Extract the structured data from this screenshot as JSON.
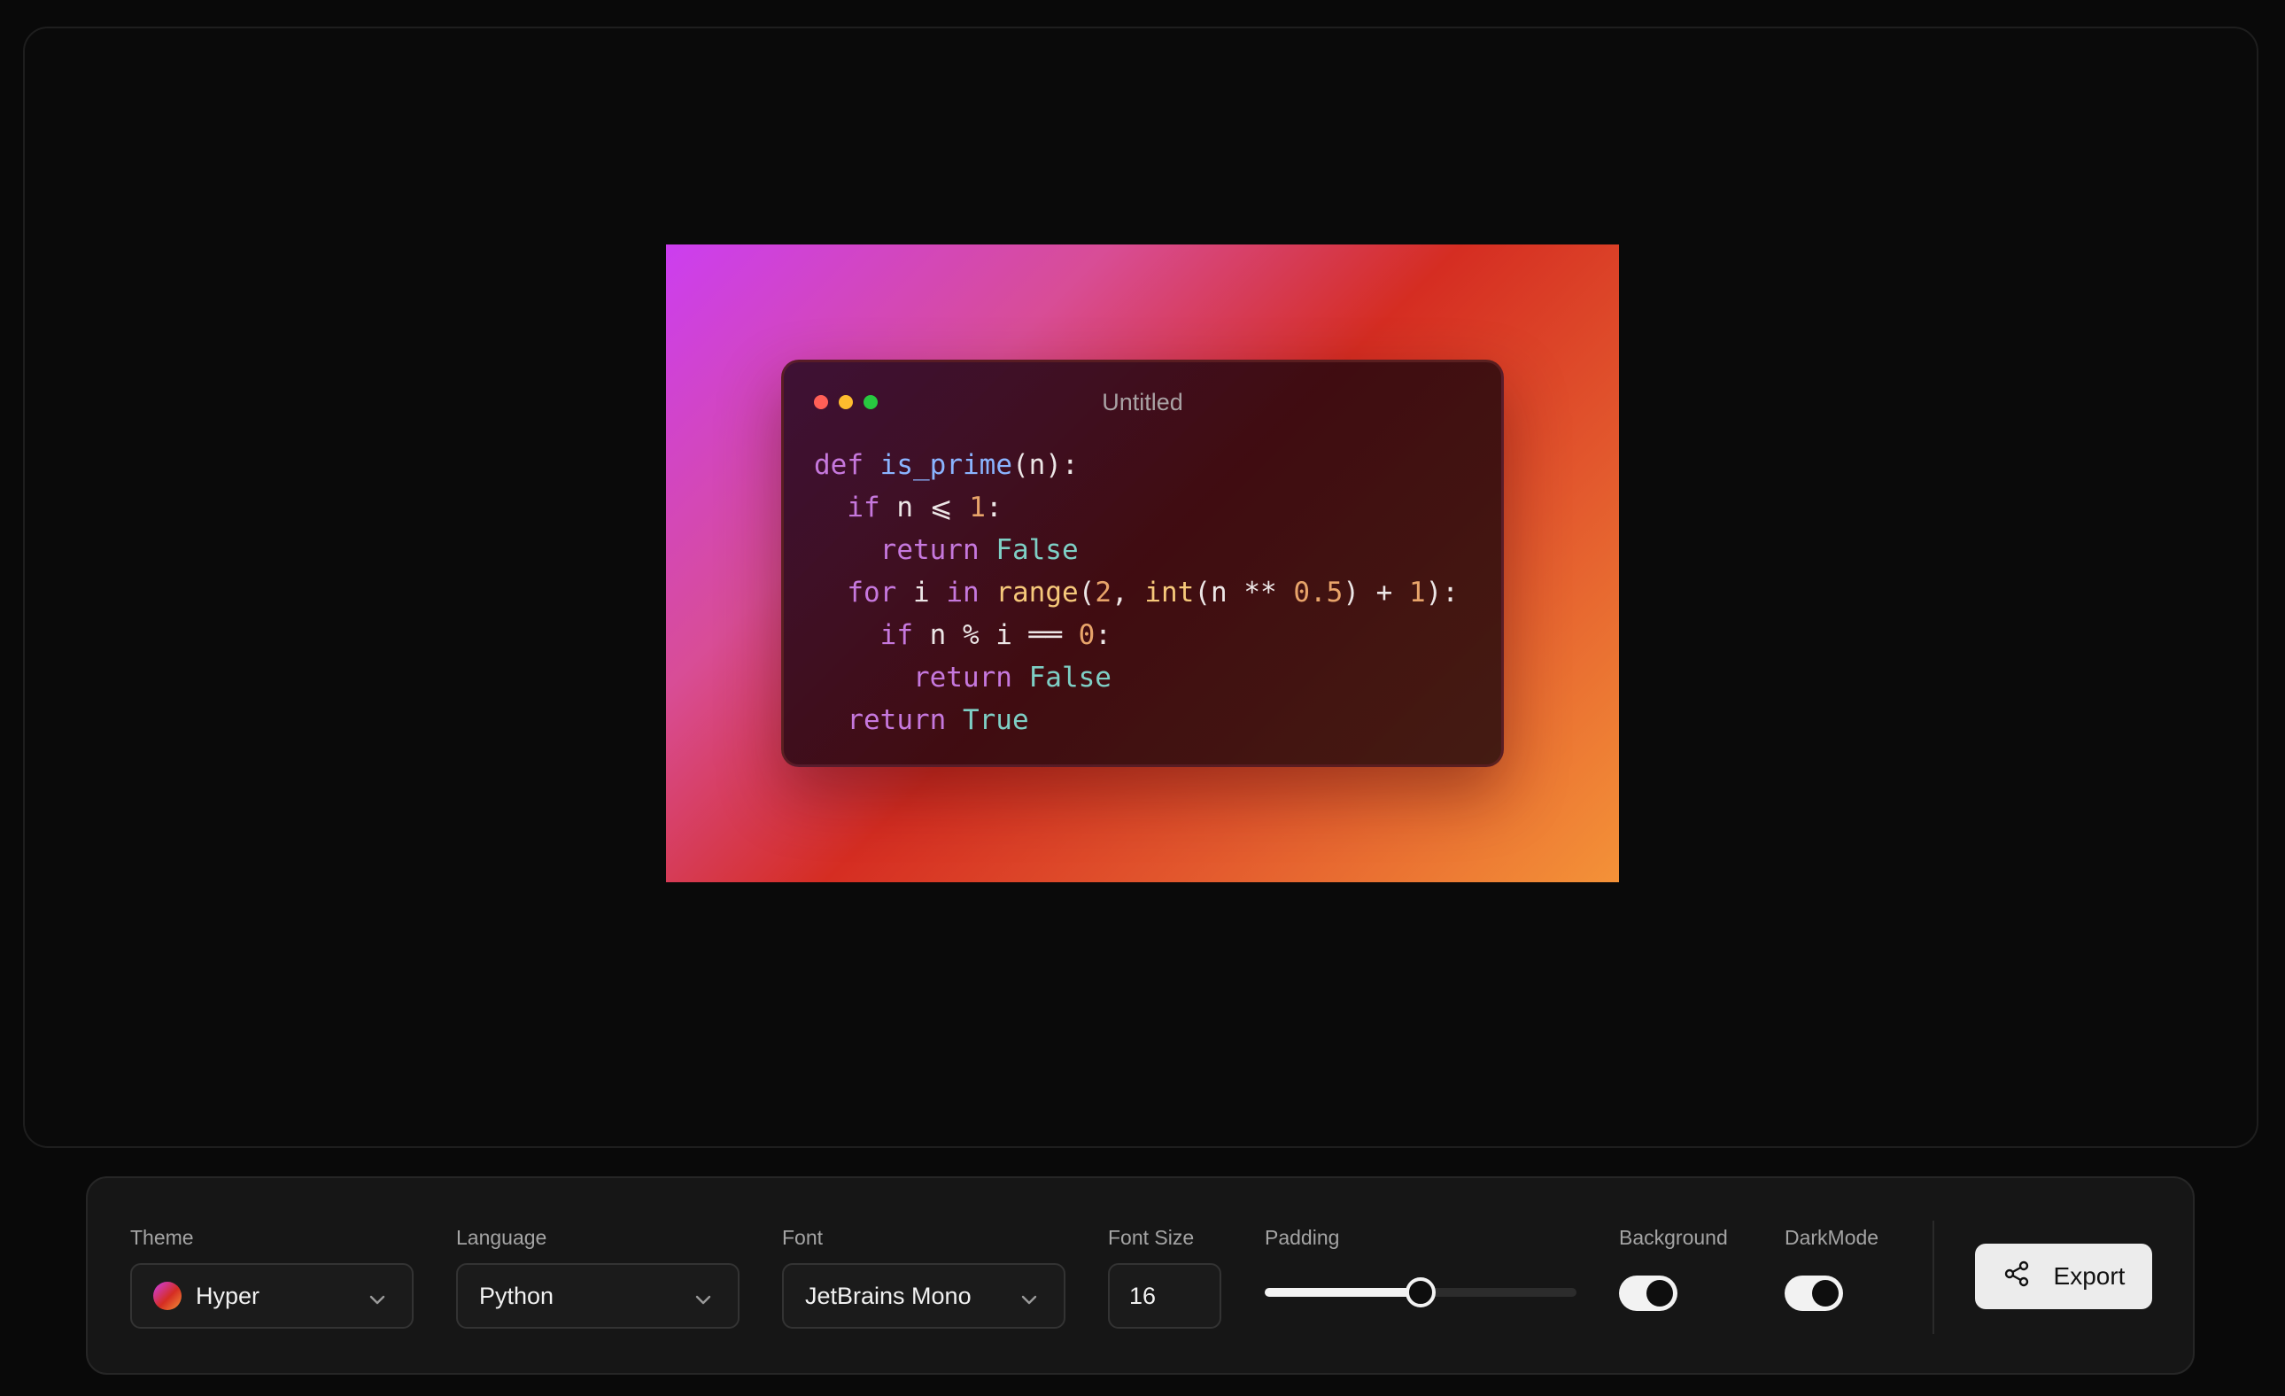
{
  "preview": {
    "window_title": "Untitled",
    "code_lines": [
      [
        {
          "t": "def",
          "c": "keyword"
        },
        {
          "t": " ",
          "c": "plain"
        },
        {
          "t": "is_prime",
          "c": "func"
        },
        {
          "t": "(n):",
          "c": "plain"
        }
      ],
      [
        {
          "t": "  ",
          "c": "plain"
        },
        {
          "t": "if",
          "c": "keyword"
        },
        {
          "t": " n ⩽ ",
          "c": "plain"
        },
        {
          "t": "1",
          "c": "num"
        },
        {
          "t": ":",
          "c": "plain"
        }
      ],
      [
        {
          "t": "    ",
          "c": "plain"
        },
        {
          "t": "return",
          "c": "keyword"
        },
        {
          "t": " ",
          "c": "plain"
        },
        {
          "t": "False",
          "c": "const"
        }
      ],
      [
        {
          "t": "  ",
          "c": "plain"
        },
        {
          "t": "for",
          "c": "keyword"
        },
        {
          "t": " i ",
          "c": "plain"
        },
        {
          "t": "in",
          "c": "keyword"
        },
        {
          "t": " ",
          "c": "plain"
        },
        {
          "t": "range",
          "c": "builtin"
        },
        {
          "t": "(",
          "c": "plain"
        },
        {
          "t": "2",
          "c": "num"
        },
        {
          "t": ", ",
          "c": "plain"
        },
        {
          "t": "int",
          "c": "builtin"
        },
        {
          "t": "(n ** ",
          "c": "plain"
        },
        {
          "t": "0.5",
          "c": "num"
        },
        {
          "t": ") + ",
          "c": "plain"
        },
        {
          "t": "1",
          "c": "num"
        },
        {
          "t": "):",
          "c": "plain"
        }
      ],
      [
        {
          "t": "    ",
          "c": "plain"
        },
        {
          "t": "if",
          "c": "keyword"
        },
        {
          "t": " n % i ══ ",
          "c": "plain"
        },
        {
          "t": "0",
          "c": "num"
        },
        {
          "t": ":",
          "c": "plain"
        }
      ],
      [
        {
          "t": "      ",
          "c": "plain"
        },
        {
          "t": "return",
          "c": "keyword"
        },
        {
          "t": " ",
          "c": "plain"
        },
        {
          "t": "False",
          "c": "const"
        }
      ],
      [
        {
          "t": "  ",
          "c": "plain"
        },
        {
          "t": "return",
          "c": "keyword"
        },
        {
          "t": " ",
          "c": "plain"
        },
        {
          "t": "True",
          "c": "const"
        }
      ]
    ]
  },
  "toolbar": {
    "theme": {
      "label": "Theme",
      "value": "Hyper",
      "icon": "chevron-down-icon"
    },
    "language": {
      "label": "Language",
      "value": "Python",
      "icon": "chevron-down-icon"
    },
    "font": {
      "label": "Font",
      "value": "JetBrains Mono",
      "icon": "chevron-down-icon"
    },
    "font_size": {
      "label": "Font Size",
      "value": "16"
    },
    "padding": {
      "label": "Padding",
      "level": 0.5
    },
    "background": {
      "label": "Background",
      "on": true
    },
    "darkmode": {
      "label": "DarkMode",
      "on": true
    },
    "export": {
      "label": "Export",
      "icon": "share-icon"
    }
  },
  "colors": {
    "page_bg": "#090909",
    "toolbar_bg": "#161616",
    "accent_light": "#ececec",
    "gradient": [
      "#cc3ef0",
      "#d52d22",
      "#f49238"
    ]
  }
}
